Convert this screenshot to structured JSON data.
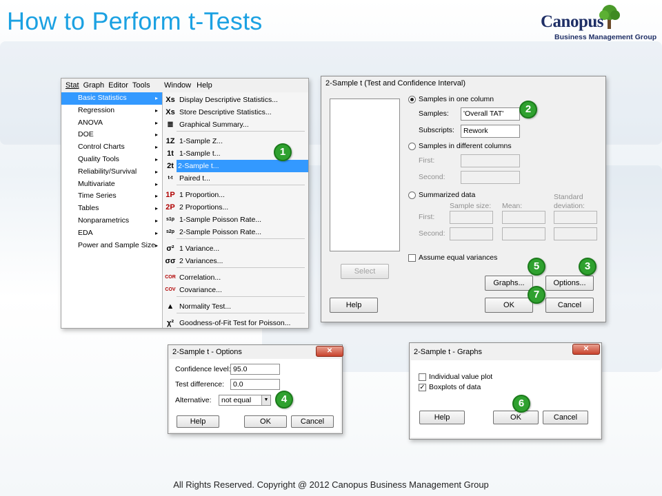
{
  "slide": {
    "title": "How to Perform t-Tests",
    "copyright": "All Rights Reserved. Copyright @ 2012  Canopus Business Management Group"
  },
  "logo": {
    "name": "Canopus",
    "subtitle": "Business Management Group"
  },
  "menu": {
    "bar": [
      "Stat",
      "Graph",
      "Editor",
      "Tools"
    ],
    "bar2": [
      "Window",
      "Help"
    ],
    "stat_items": [
      {
        "label": "Basic Statistics",
        "arrow": "▸",
        "highlighted": true
      },
      {
        "label": "Regression",
        "arrow": "▸"
      },
      {
        "label": "ANOVA",
        "arrow": "▸"
      },
      {
        "label": "DOE",
        "arrow": "▸"
      },
      {
        "label": "Control Charts",
        "arrow": "▸"
      },
      {
        "label": "Quality Tools",
        "arrow": "▸"
      },
      {
        "label": "Reliability/Survival",
        "arrow": "▸"
      },
      {
        "label": "Multivariate",
        "arrow": "▸"
      },
      {
        "label": "Time Series",
        "arrow": "▸"
      },
      {
        "label": "Tables",
        "arrow": "▸"
      },
      {
        "label": "Nonparametrics",
        "arrow": "▸"
      },
      {
        "label": "EDA",
        "arrow": "▸"
      },
      {
        "label": "Power and Sample Size",
        "arrow": "▸"
      }
    ],
    "basic_stats_items": [
      {
        "icon": "Xs",
        "label": "Display Descriptive Statistics..."
      },
      {
        "icon": "Xs",
        "label": "Store Descriptive Statistics..."
      },
      {
        "icon": "≣",
        "label": "Graphical Summary..."
      },
      {
        "icon": "1Z",
        "label": "1-Sample Z..."
      },
      {
        "icon": "1t",
        "label": "1-Sample t..."
      },
      {
        "icon": "2t",
        "label": "2-Sample t...",
        "highlighted": true
      },
      {
        "icon": "t-t",
        "label": "Paired t..."
      },
      {
        "icon": "1P",
        "label": "1 Proportion...",
        "red": true
      },
      {
        "icon": "2P",
        "label": "2 Proportions...",
        "red": true
      },
      {
        "icon": "s1p",
        "label": "1-Sample Poisson Rate..."
      },
      {
        "icon": "s2p",
        "label": "2-Sample Poisson Rate..."
      },
      {
        "icon": "σ²",
        "label": "1 Variance..."
      },
      {
        "icon": "σσ",
        "label": "2 Variances..."
      },
      {
        "icon": "COR",
        "label": "Correlation...",
        "red": true
      },
      {
        "icon": "COV",
        "label": "Covariance...",
        "red": true
      },
      {
        "icon": "▲",
        "label": "Normality Test..."
      },
      {
        "icon": "χ²",
        "label": "Goodness-of-Fit Test for Poisson..."
      }
    ]
  },
  "main_dialog": {
    "title": "2-Sample t (Test and Confidence Interval)",
    "opt_one_column": "Samples in one column",
    "samples_label": "Samples:",
    "samples_value": "'Overall TAT'",
    "subscripts_label": "Subscripts:",
    "subscripts_value": "Rework",
    "opt_diff_columns": "Samples in different columns",
    "first_label": "First:",
    "second_label": "Second:",
    "opt_summarized": "Summarized data",
    "sample_size_label": "Sample size:",
    "mean_label": "Mean:",
    "std_label_1": "Standard",
    "std_label_2": "deviation:",
    "assume_equal": "Assume equal variances",
    "select_btn": "Select",
    "graphs_btn": "Graphs...",
    "options_btn": "Options...",
    "help_btn": "Help",
    "ok_btn": "OK",
    "cancel_btn": "Cancel"
  },
  "options_dialog": {
    "title": "2-Sample t - Options",
    "conf_label": "Confidence level:",
    "conf_value": "95.0",
    "diff_label": "Test difference:",
    "diff_value": "0.0",
    "alt_label": "Alternative:",
    "alt_value": "not equal",
    "help_btn": "Help",
    "ok_btn": "OK",
    "cancel_btn": "Cancel",
    "close_glyph": "✕"
  },
  "graphs_dialog": {
    "title": "2-Sample t - Graphs",
    "individual_value": "Individual value plot",
    "boxplots": "Boxplots of data",
    "help_btn": "Help",
    "ok_btn": "OK",
    "cancel_btn": "Cancel",
    "close_glyph": "✕"
  },
  "badges": [
    "1",
    "2",
    "3",
    "4",
    "5",
    "6",
    "7"
  ],
  "colors": {
    "title_blue": "#1ba1e2",
    "highlight": "#3399ff",
    "badge_green": "#2fa12f",
    "logo_navy": "#1f2f66"
  }
}
